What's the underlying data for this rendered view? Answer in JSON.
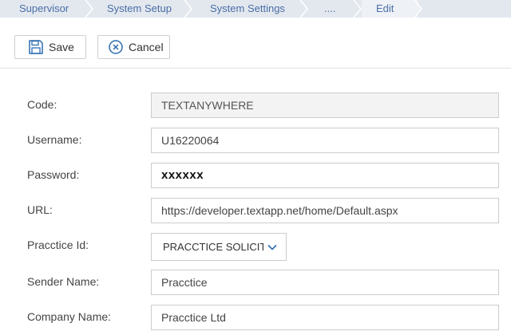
{
  "breadcrumb": {
    "items": [
      "Supervisor",
      "System Setup",
      "System Settings",
      "....",
      "Edit"
    ]
  },
  "toolbar": {
    "save_label": "Save",
    "cancel_label": "Cancel"
  },
  "form": {
    "code_label": "Code:",
    "code_value": "TEXTANYWHERE",
    "username_label": "Username:",
    "username_value": "U16220064",
    "password_label": "Password:",
    "password_value": "xxxxxx",
    "url_label": "URL:",
    "url_value": "https://developer.textapp.net/home/Default.aspx",
    "pracctice_id_label": "Pracctice Id:",
    "pracctice_id_value": "PRACCTICE SOLICITO",
    "sender_name_label": "Sender Name:",
    "sender_name_value": "Pracctice",
    "company_name_label": "Company Name:",
    "company_name_value": "Pracctice Ltd"
  },
  "colors": {
    "breadcrumb_bg": "#e3e8ee",
    "breadcrumb_text": "#4a6ea8",
    "accent_icon": "#2b6cb0"
  },
  "icons": [
    "save-icon",
    "cancel-icon",
    "chevron-down-icon"
  ]
}
